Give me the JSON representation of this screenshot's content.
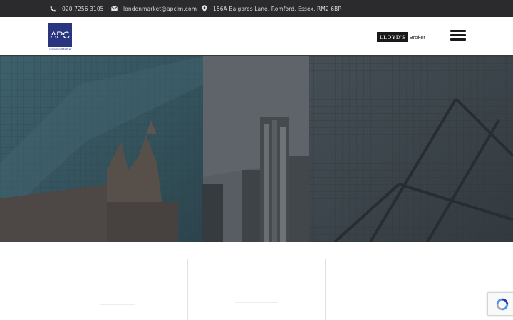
{
  "topbar": {
    "phone": "020 7256 3105",
    "email": "londonmarket@apclm.com",
    "address": "156A Balgores Lane, Romford, Essex, RM2 6BP",
    "icons": [
      "phone-icon",
      "envelope-icon",
      "map-pin-icon"
    ]
  },
  "header": {
    "logo_mark": "APC",
    "logo_sub": "London Market",
    "lloyds_name": "LLOYD'S",
    "lloyds_role": "Broker",
    "menu_icon": "hamburger-menu-icon"
  },
  "colors": {
    "topbar_bg": "#2b2b2d",
    "brand_navy": "#2a3580",
    "hero_overlay": "#2a2f35"
  },
  "recaptcha": {
    "icon": "recaptcha-icon"
  }
}
